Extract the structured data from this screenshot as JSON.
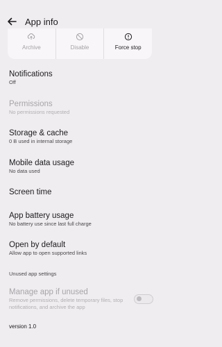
{
  "header": {
    "title": "App info"
  },
  "actions": [
    {
      "label": "Archive",
      "icon": "archive-icon",
      "enabled": false
    },
    {
      "label": "Disable",
      "icon": "disable-icon",
      "enabled": false
    },
    {
      "label": "Force stop",
      "icon": "force-stop-icon",
      "enabled": true
    }
  ],
  "items": [
    {
      "primary": "Notifications",
      "secondary": "Off"
    },
    {
      "primary": "Permissions",
      "secondary": "No permissions requested"
    },
    {
      "primary": "Storage & cache",
      "secondary": "0 B used in internal storage"
    },
    {
      "primary": "Mobile data usage",
      "secondary": "No data used"
    },
    {
      "primary": "Screen time"
    },
    {
      "primary": "App battery usage",
      "secondary": "No battery use since last full charge"
    },
    {
      "primary": "Open by default",
      "secondary": "Allow app to open supported links"
    }
  ],
  "unused_section": {
    "header": "Unused app settings",
    "manage_title": "Manage app if unused",
    "manage_subtitle": "Remove permissions, delete temporary files, stop notifications, and archive the app",
    "toggle_on": false
  },
  "footer": {
    "version": "version 1.0"
  },
  "colors": {
    "background": "#efedef",
    "card": "#f8f6f8",
    "disabled_text": "#a7a5a9"
  }
}
